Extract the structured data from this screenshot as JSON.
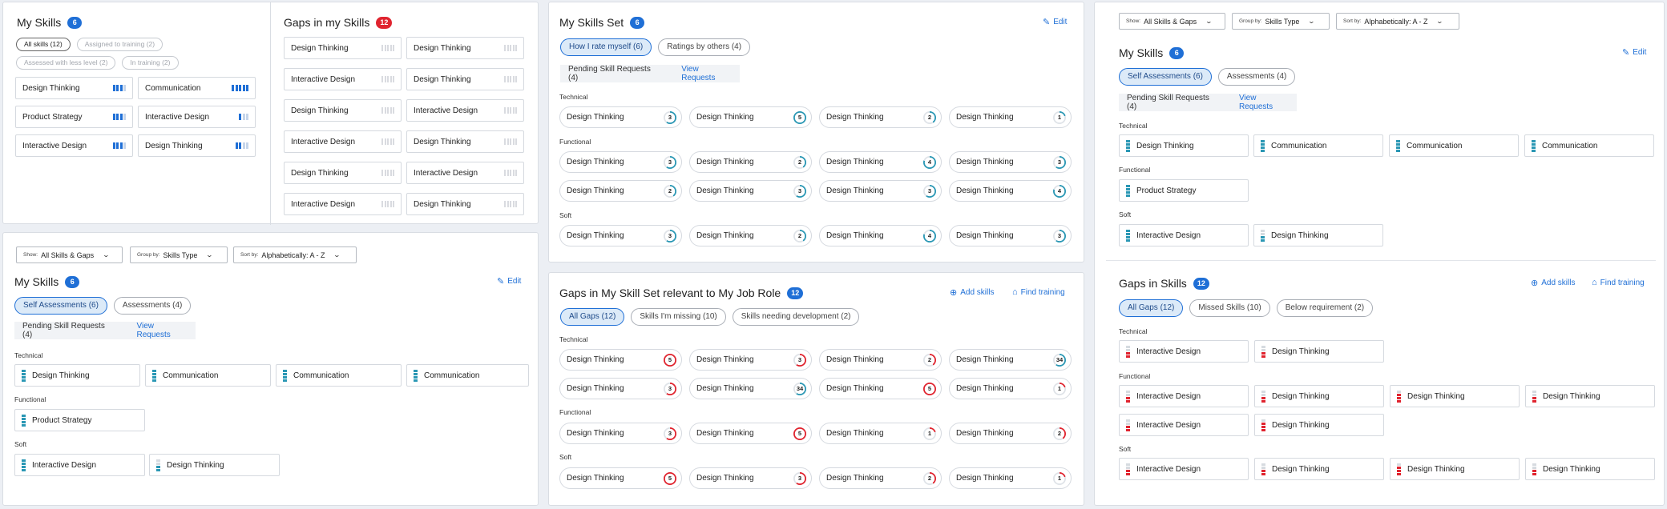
{
  "p1": {
    "title": "My Skills",
    "badge": "6",
    "chips": [
      "All skills (12)",
      "Assigned to training (2)",
      "Assessed with less level (2)",
      "In training (2)"
    ],
    "skills": [
      "Design Thinking",
      "Communication",
      "Product Strategy",
      "Interactive Design",
      "Interactive Design",
      "Design Thinking"
    ]
  },
  "p2": {
    "title": "Gaps in my Skills",
    "badge": "12",
    "skills": [
      "Design Thinking",
      "Design Thinking",
      "Interactive Design",
      "Design Thinking",
      "Design Thinking",
      "Interactive Design",
      "Interactive Design",
      "Design Thinking",
      "Design Thinking",
      "Interactive Design",
      "Interactive Design",
      "Design Thinking"
    ]
  },
  "p3": {
    "title": "My Skills Set",
    "badge": "6",
    "edit": "Edit",
    "chips": [
      "How I rate myself (6)",
      "Ratings by others (4)"
    ],
    "pending": "Pending Skill Requests (4)",
    "view": "View Requests",
    "groups": [
      "Technical",
      "Functional",
      "Soft"
    ],
    "rows": [
      [
        [
          "Design Thinking",
          "3"
        ],
        [
          "Design Thinking",
          "5"
        ],
        [
          "Design Thinking",
          "2"
        ],
        [
          "Design Thinking",
          "1"
        ]
      ],
      [
        [
          "Design Thinking",
          "3"
        ],
        [
          "Design Thinking",
          "2"
        ],
        [
          "Design Thinking",
          "4"
        ],
        [
          "Design Thinking",
          "3"
        ]
      ],
      [
        [
          "Design Thinking",
          "2"
        ],
        [
          "Design Thinking",
          "3"
        ],
        [
          "Design Thinking",
          "3"
        ],
        [
          "Design Thinking",
          "4"
        ]
      ],
      [
        [
          "Design Thinking",
          "3"
        ],
        [
          "Design Thinking",
          "2"
        ],
        [
          "Design Thinking",
          "4"
        ],
        [
          "Design Thinking",
          "3"
        ]
      ]
    ]
  },
  "p4": {
    "title": "Gaps in My Skill Set relevant to My Job Role",
    "badge": "12",
    "add": "Add skills",
    "find": "Find training",
    "chips": [
      "All Gaps (12)",
      "Skills I'm missing (10)",
      "Skills needing development (2)"
    ],
    "groups": [
      "Technical",
      "Functional",
      "Soft"
    ],
    "rows": [
      [
        [
          "Design Thinking",
          "5"
        ],
        [
          "Design Thinking",
          "3"
        ],
        [
          "Design Thinking",
          "2"
        ],
        [
          "Design Thinking",
          "3 4"
        ]
      ],
      [
        [
          "Design Thinking",
          "3"
        ],
        [
          "Design Thinking",
          "3 4"
        ],
        [
          "Design Thinking",
          "5"
        ],
        [
          "Design Thinking",
          "1"
        ]
      ],
      [
        [
          "Design Thinking",
          "3"
        ],
        [
          "Design Thinking",
          "5"
        ],
        [
          "Design Thinking",
          "1"
        ],
        [
          "Design Thinking",
          "2"
        ]
      ],
      [
        [
          "Design Thinking",
          "5"
        ],
        [
          "Design Thinking",
          "3"
        ],
        [
          "Design Thinking",
          "2"
        ],
        [
          "Design Thinking",
          "1"
        ]
      ]
    ]
  },
  "p5": {
    "show_label": "Show:",
    "show": "All Skills & Gaps",
    "group_label": "Group by:",
    "group": "Skills Type",
    "sort_label": "Sort by:",
    "sort": "Alphabetically: A - Z",
    "title": "My Skills",
    "badge": "6",
    "edit": "Edit",
    "chips": [
      "Self Assessments (6)",
      "Assessments (4)"
    ],
    "pending": "Pending Skill Requests (4)",
    "view": "View Requests",
    "groups": [
      "Technical",
      "Functional",
      "Soft"
    ],
    "technical": [
      "Design Thinking",
      "Communication",
      "Communication",
      "Communication"
    ],
    "functional": [
      "Product Strategy"
    ],
    "soft": [
      "Interactive Design",
      "Design Thinking"
    ]
  },
  "p6": {
    "show_label": "Show:",
    "show": "All Skills & Gaps",
    "group_label": "Group by:",
    "group": "Skills Type",
    "sort_label": "Sort by:",
    "sort": "Alphabetically: A - Z",
    "title": "My Skills",
    "badge": "6",
    "edit": "Edit",
    "chips": [
      "Self Assessments (6)",
      "Assessments (4)"
    ],
    "pending": "Pending Skill Requests (4)",
    "view": "View Requests",
    "groups": [
      "Technical",
      "Functional",
      "Soft"
    ],
    "technical": [
      "Design Thinking",
      "Communication",
      "Communication",
      "Communication"
    ],
    "functional": [
      "Product Strategy"
    ],
    "soft": [
      "Interactive Design",
      "Design Thinking"
    ]
  },
  "p7": {
    "title": "Gaps in Skills",
    "badge": "12",
    "add": "Add skills",
    "find": "Find training",
    "chips": [
      "All Gaps (12)",
      "Missed Skills (10)",
      "Below requirement (2)"
    ],
    "groups": [
      "Technical",
      "Functional",
      "Soft"
    ],
    "technical": [
      "Interactive Design",
      "Design Thinking"
    ],
    "functional": [
      "Interactive Design",
      "Design Thinking",
      "Design Thinking",
      "Design Thinking",
      "Interactive Design",
      "Design Thinking"
    ],
    "soft": [
      "Interactive Design",
      "Design Thinking",
      "Design Thinking",
      "Design Thinking"
    ]
  }
}
